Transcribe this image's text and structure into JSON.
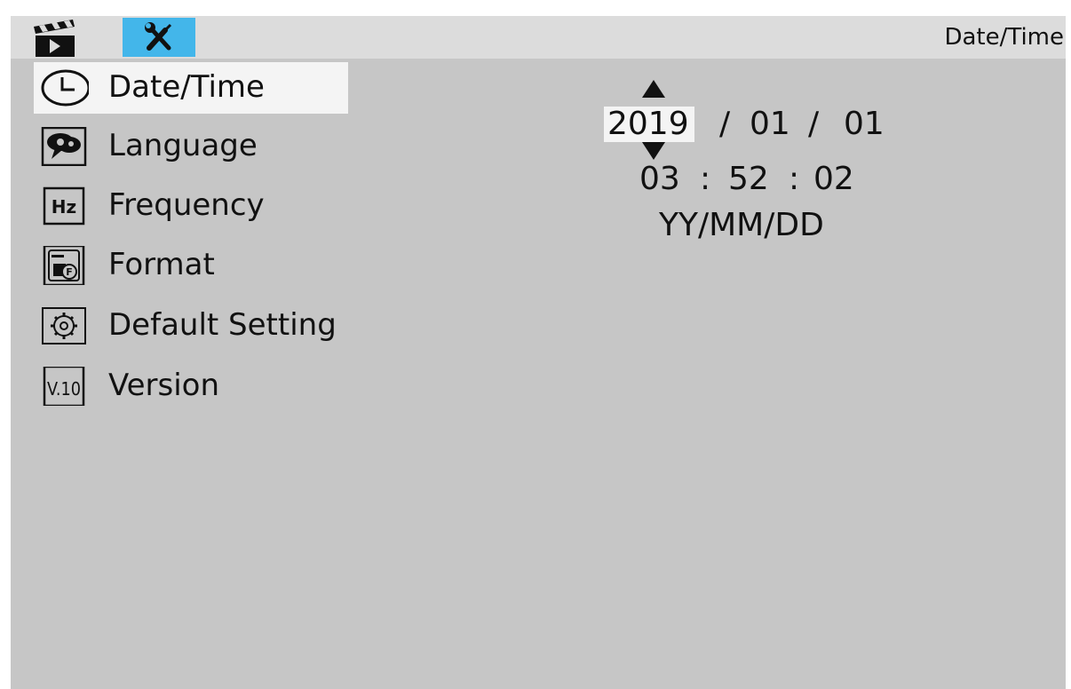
{
  "topbar": {
    "tabs": [
      {
        "icon": "clapperboard-play-icon",
        "active": false
      },
      {
        "icon": "wrench-screwdriver-icon",
        "active": true
      }
    ],
    "active_tab_color": "#43b6ea",
    "heading": "Date/Time"
  },
  "menu": {
    "items": [
      {
        "label": "Date/Time",
        "icon": "clock-icon",
        "selected": true
      },
      {
        "label": "Language",
        "icon": "speech-bubble-icon",
        "selected": false
      },
      {
        "label": "Frequency",
        "icon": "hz-icon",
        "selected": false
      },
      {
        "label": "Format",
        "icon": "sd-card-format-icon",
        "selected": false
      },
      {
        "label": "Default Setting",
        "icon": "gear-reset-icon",
        "selected": false
      },
      {
        "label": "Version",
        "icon": "version-icon",
        "version_text": "V.10",
        "selected": false
      }
    ]
  },
  "datetime": {
    "year": "2019",
    "date_separator": "/",
    "month": "01",
    "day": "01",
    "hour": "03",
    "time_separator": ":",
    "minute": "52",
    "second": "02",
    "date_format": "YY/MM/DD"
  },
  "colors": {
    "screen_bg": "#c6c6c6",
    "topbar_bg": "#dcdcdc",
    "selection_bg": "#f4f4f4"
  }
}
